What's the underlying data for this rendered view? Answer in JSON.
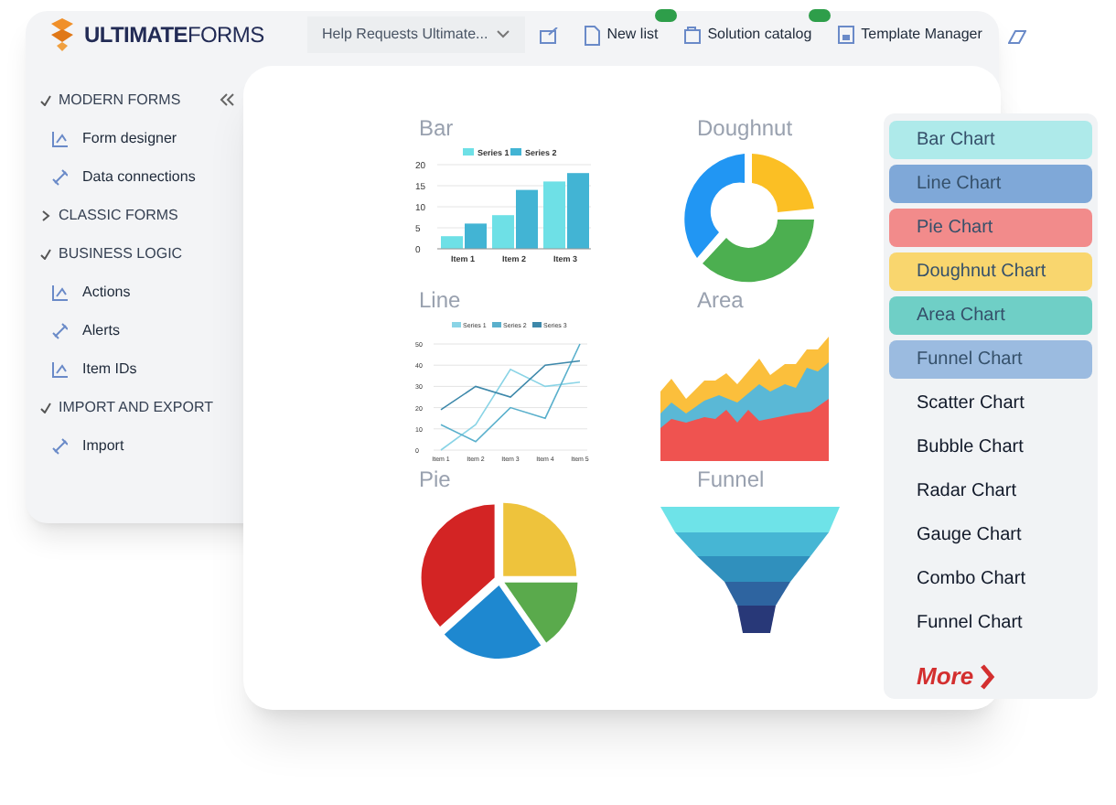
{
  "header": {
    "logo": "**ULTIMATE**FORMS",
    "list_select": {
      "value": "Help Requests Ultimate..."
    },
    "toolbar": [
      {
        "label": "New list",
        "kind": "badged"
      },
      {
        "label": "Solution catalog",
        "kind": "badged"
      },
      {
        "label": "Template Manager",
        "kind": "plain"
      }
    ]
  },
  "sidebar": {
    "sections": [
      {
        "title": "MODERN FORMS",
        "expanded": true,
        "items": [
          "Form designer",
          "Data connections"
        ]
      },
      {
        "title": "CLASSIC FORMS",
        "expanded": false
      },
      {
        "title": "BUSINESS LOGIC",
        "expanded": true,
        "items": [
          "Actions",
          "Alerts",
          "Item IDs"
        ]
      },
      {
        "title": "IMPORT AND EXPORT",
        "expanded": true,
        "items": [
          "Import"
        ]
      }
    ]
  },
  "charts": [
    {
      "title": "Bar",
      "chart_data": {
        "type": "bar",
        "categories": [
          "Item 1",
          "Item 2",
          "Item 3"
        ],
        "series": [
          {
            "name": "Series 1",
            "color": "#6ee0e6",
            "values": [
              3,
              8,
              16
            ]
          },
          {
            "name": "Series 2",
            "color": "#42b4d4",
            "values": [
              6,
              14,
              18
            ]
          }
        ],
        "ylim": [
          0,
          20
        ],
        "yticks": [
          0,
          5,
          10,
          15,
          20
        ],
        "grid": true,
        "legend": true
      }
    },
    {
      "title": "Doughnut"
    },
    {
      "title": "Line",
      "chart_data": {
        "type": "line",
        "categories": [
          "Item 1",
          "Item 2",
          "Item 3",
          "Item 4",
          "Item 5"
        ],
        "series": [
          {
            "name": "Series 1",
            "color": "#8ad4e6",
            "values": [
              0,
              12,
              38,
              30,
              32
            ]
          },
          {
            "name": "Series 2",
            "color": "#5ab0cc",
            "values": [
              12,
              4,
              20,
              15,
              50
            ]
          },
          {
            "name": "Series 3",
            "color": "#3d88aa",
            "values": [
              19,
              30,
              25,
              40,
              42
            ]
          }
        ],
        "ylim": [
          0,
          50
        ],
        "yticks": [
          0,
          10,
          20,
          30,
          40,
          50
        ],
        "grid": true,
        "legend": true
      }
    },
    {
      "title": "Area"
    },
    {
      "title": "Pie"
    },
    {
      "title": "Funnel"
    }
  ],
  "chart_types": [
    {
      "label": "Bar Chart",
      "color": "#aeeaea"
    },
    {
      "label": "Line Chart",
      "color": "#7fa8d8"
    },
    {
      "label": "Pie Chart",
      "color": "#f28b8b"
    },
    {
      "label": "Doughnut Chart",
      "color": "#f9d66e"
    },
    {
      "label": "Area Chart",
      "color": "#6fcfc6"
    },
    {
      "label": "Funnel Chart",
      "color": "#9bbbe0"
    },
    {
      "label": "Scatter Chart"
    },
    {
      "label": "Bubble Chart"
    },
    {
      "label": "Radar Chart"
    },
    {
      "label": "Gauge Chart"
    },
    {
      "label": "Combo Chart"
    },
    {
      "label": "Funnel Chart"
    }
  ],
  "more_link": "More"
}
